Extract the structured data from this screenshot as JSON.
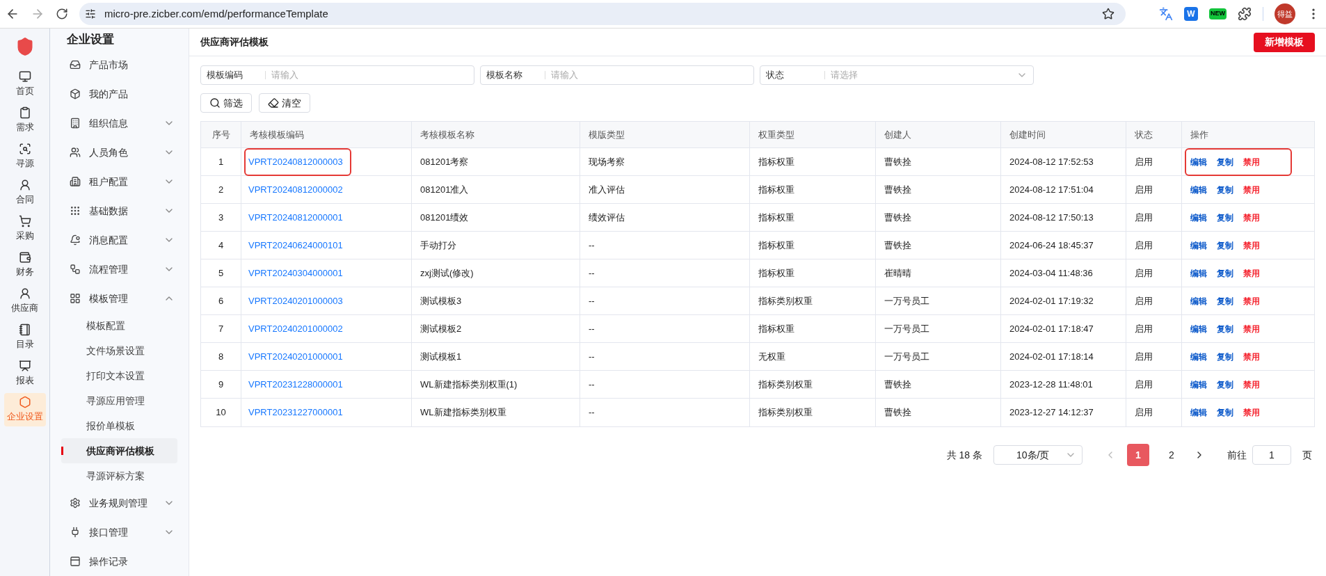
{
  "browser": {
    "url": "micro-pre.zicber.com/emd/performanceTemplate",
    "extensions": [
      {
        "kind": "translate"
      },
      {
        "kind": "w",
        "label": "W"
      },
      {
        "kind": "new",
        "label": "NEW"
      },
      {
        "kind": "puzzle"
      }
    ],
    "profile": "得益"
  },
  "rail": {
    "items": [
      {
        "label": "首页",
        "kind": "monitor",
        "selected": false
      },
      {
        "label": "需求",
        "kind": "clipboard",
        "selected": false
      },
      {
        "label": "寻源",
        "kind": "search",
        "selected": false
      },
      {
        "label": "合同",
        "kind": "user",
        "selected": false
      },
      {
        "label": "采购",
        "kind": "cart",
        "selected": false
      },
      {
        "label": "财务",
        "kind": "wallet",
        "selected": false
      },
      {
        "label": "供应商",
        "kind": "user",
        "selected": false
      },
      {
        "label": "目录",
        "kind": "notebook",
        "selected": false
      },
      {
        "label": "报表",
        "kind": "report",
        "selected": false
      },
      {
        "label": "企业设置",
        "kind": "hexagon",
        "selected": true
      }
    ]
  },
  "sidebar": {
    "title": "企业设置",
    "items": [
      {
        "label": "产品市场",
        "kind": "inbox"
      },
      {
        "label": "我的产品",
        "kind": "box"
      },
      {
        "label": "组织信息",
        "kind": "building",
        "expanded": false
      },
      {
        "label": "人员角色",
        "kind": "users",
        "expanded": false
      },
      {
        "label": "租户配置",
        "kind": "tenant",
        "expanded": false
      },
      {
        "label": "基础数据",
        "kind": "grip",
        "expanded": false
      },
      {
        "label": "消息配置",
        "kind": "bell",
        "expanded": false
      },
      {
        "label": "流程管理",
        "kind": "flow",
        "expanded": false
      },
      {
        "label": "模板管理",
        "kind": "grid",
        "expanded": true,
        "children": [
          {
            "label": "模板配置",
            "selected": false
          },
          {
            "label": "文件场景设置",
            "selected": false
          },
          {
            "label": "打印文本设置",
            "selected": false
          },
          {
            "label": "寻源应用管理",
            "selected": false
          },
          {
            "label": "报价单模板",
            "selected": false
          },
          {
            "label": "供应商评估模板",
            "selected": true
          },
          {
            "label": "寻源评标方案",
            "selected": false
          }
        ]
      },
      {
        "label": "业务规则管理",
        "kind": "gear",
        "expanded": false
      },
      {
        "label": "接口管理",
        "kind": "plug",
        "expanded": false
      },
      {
        "label": "操作记录",
        "kind": "log"
      }
    ]
  },
  "page": {
    "title": "供应商评估模板",
    "add_button": "新增模板"
  },
  "filters": [
    {
      "label": "模板编码",
      "placeholder": "请输入",
      "kind": "input"
    },
    {
      "label": "模板名称",
      "placeholder": "请输入",
      "kind": "input"
    },
    {
      "label": "状态",
      "placeholder": "请选择",
      "kind": "select"
    }
  ],
  "buttons": [
    {
      "label": "筛选",
      "kind": "search"
    },
    {
      "label": "清空",
      "kind": "clear"
    }
  ],
  "table": {
    "columns": [
      "序号",
      "考核模板编码",
      "考核模板名称",
      "模版类型",
      "权重类型",
      "创建人",
      "创建时间",
      "状态",
      "操作"
    ],
    "rows": [
      {
        "cells": [
          "1",
          "VPRT20240812000003",
          "081201考察",
          "现场考察",
          "指标权重",
          "曹铁拴",
          "2024-08-12 17:52:53",
          "启用"
        ],
        "highlighted": true,
        "actions": [
          {
            "label": "编辑",
            "kind": "primary"
          },
          {
            "label": "复制",
            "kind": "primary"
          },
          {
            "label": "禁用",
            "kind": "danger"
          }
        ]
      },
      {
        "cells": [
          "2",
          "VPRT20240812000002",
          "081201准入",
          "准入评估",
          "指标权重",
          "曹铁拴",
          "2024-08-12 17:51:04",
          "启用"
        ],
        "highlighted": false,
        "actions": [
          {
            "label": "编辑",
            "kind": "primary"
          },
          {
            "label": "复制",
            "kind": "primary"
          },
          {
            "label": "禁用",
            "kind": "danger"
          }
        ]
      },
      {
        "cells": [
          "3",
          "VPRT20240812000001",
          "081201绩效",
          "绩效评估",
          "指标权重",
          "曹铁拴",
          "2024-08-12 17:50:13",
          "启用"
        ],
        "highlighted": false,
        "actions": [
          {
            "label": "编辑",
            "kind": "primary"
          },
          {
            "label": "复制",
            "kind": "primary"
          },
          {
            "label": "禁用",
            "kind": "danger"
          }
        ]
      },
      {
        "cells": [
          "4",
          "VPRT20240624000101",
          "手动打分",
          "--",
          "指标权重",
          "曹铁拴",
          "2024-06-24 18:45:37",
          "启用"
        ],
        "highlighted": false,
        "actions": [
          {
            "label": "编辑",
            "kind": "primary"
          },
          {
            "label": "复制",
            "kind": "primary"
          },
          {
            "label": "禁用",
            "kind": "danger"
          }
        ]
      },
      {
        "cells": [
          "5",
          "VPRT20240304000001",
          "zxj测试(修改)",
          "--",
          "指标权重",
          "崔晴晴",
          "2024-03-04 11:48:36",
          "启用"
        ],
        "highlighted": false,
        "actions": [
          {
            "label": "编辑",
            "kind": "primary"
          },
          {
            "label": "复制",
            "kind": "primary"
          },
          {
            "label": "禁用",
            "kind": "danger"
          }
        ]
      },
      {
        "cells": [
          "6",
          "VPRT20240201000003",
          "测试模板3",
          "--",
          "指标类别权重",
          "一万号员工",
          "2024-02-01 17:19:32",
          "启用"
        ],
        "highlighted": false,
        "actions": [
          {
            "label": "编辑",
            "kind": "primary"
          },
          {
            "label": "复制",
            "kind": "primary"
          },
          {
            "label": "禁用",
            "kind": "danger"
          }
        ]
      },
      {
        "cells": [
          "7",
          "VPRT20240201000002",
          "测试模板2",
          "--",
          "指标权重",
          "一万号员工",
          "2024-02-01 17:18:47",
          "启用"
        ],
        "highlighted": false,
        "actions": [
          {
            "label": "编辑",
            "kind": "primary"
          },
          {
            "label": "复制",
            "kind": "primary"
          },
          {
            "label": "禁用",
            "kind": "danger"
          }
        ]
      },
      {
        "cells": [
          "8",
          "VPRT20240201000001",
          "测试模板1",
          "--",
          "无权重",
          "一万号员工",
          "2024-02-01 17:18:14",
          "启用"
        ],
        "highlighted": false,
        "actions": [
          {
            "label": "编辑",
            "kind": "primary"
          },
          {
            "label": "复制",
            "kind": "primary"
          },
          {
            "label": "禁用",
            "kind": "danger"
          }
        ]
      },
      {
        "cells": [
          "9",
          "VPRT20231228000001",
          "WL新建指标类别权重(1)",
          "--",
          "指标类别权重",
          "曹铁拴",
          "2023-12-28 11:48:01",
          "启用"
        ],
        "highlighted": false,
        "actions": [
          {
            "label": "编辑",
            "kind": "primary"
          },
          {
            "label": "复制",
            "kind": "primary"
          },
          {
            "label": "禁用",
            "kind": "danger"
          }
        ]
      },
      {
        "cells": [
          "10",
          "VPRT20231227000001",
          "WL新建指标类别权重",
          "--",
          "指标类别权重",
          "曹铁拴",
          "2023-12-27 14:12:37",
          "启用"
        ],
        "highlighted": false,
        "actions": [
          {
            "label": "编辑",
            "kind": "primary"
          },
          {
            "label": "复制",
            "kind": "primary"
          },
          {
            "label": "禁用",
            "kind": "danger"
          }
        ]
      }
    ]
  },
  "pagination": {
    "total": "共 18 条",
    "page_size": "10条/页",
    "pages": [
      {
        "label": "1",
        "selected": true
      },
      {
        "label": "2",
        "selected": false
      }
    ],
    "goto_label": "前往",
    "goto_value": "1",
    "goto_suffix": "页"
  }
}
